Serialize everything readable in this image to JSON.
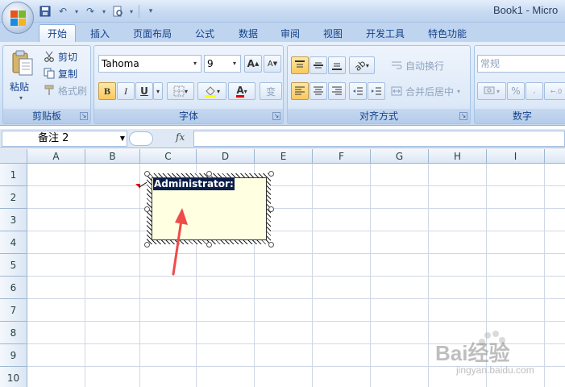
{
  "window": {
    "title": "Book1 - Micro"
  },
  "tabs": [
    {
      "label": "开始",
      "active": true
    },
    {
      "label": "插入"
    },
    {
      "label": "页面布局"
    },
    {
      "label": "公式"
    },
    {
      "label": "数据"
    },
    {
      "label": "审阅"
    },
    {
      "label": "视图"
    },
    {
      "label": "开发工具"
    },
    {
      "label": "特色功能"
    }
  ],
  "clipboard": {
    "label": "剪贴板",
    "paste": "粘贴",
    "cut": "剪切",
    "copy": "复制",
    "format_painter": "格式刷"
  },
  "font": {
    "label": "字体",
    "font_name": "Tahoma",
    "font_size": "9",
    "bold": "B",
    "italic": "I",
    "underline": "U",
    "phonetic": "变"
  },
  "alignment": {
    "label": "对齐方式",
    "wrap_text": "自动换行",
    "merge_center": "合并后居中"
  },
  "number": {
    "label": "数字",
    "format": "常规",
    "percent": "%"
  },
  "formula_bar": {
    "name_box": "备注 2",
    "fx": "fx",
    "content": ""
  },
  "sheet": {
    "columns": [
      "A",
      "B",
      "C",
      "D",
      "E",
      "F",
      "G",
      "H",
      "I"
    ],
    "rows": [
      "1",
      "2",
      "3",
      "4",
      "5",
      "6",
      "7",
      "8",
      "9",
      "10"
    ]
  },
  "comment": {
    "author": "Administrator:"
  },
  "colors": {
    "annotation_arrow": "#f04a4a",
    "comment_fill": "#ffffe1",
    "selection": "#0a1e4a"
  },
  "watermark": {
    "text": "Bai经验",
    "sub": "jingyan.baidu.com"
  }
}
